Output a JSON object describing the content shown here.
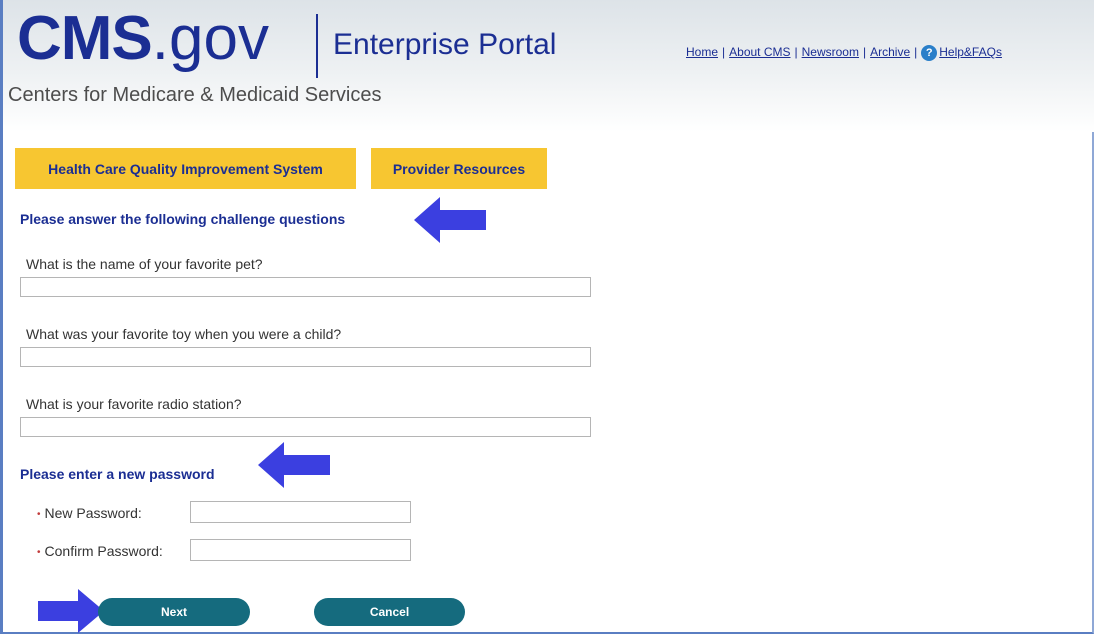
{
  "header": {
    "logo_main": "CMS",
    "logo_suffix": ".gov",
    "portal_title": "Enterprise Portal",
    "tagline": "Centers for Medicare & Medicaid Services",
    "nav": {
      "home": "Home",
      "about": "About CMS",
      "newsroom": "Newsroom",
      "archive": "Archive",
      "help": "Help&FAQs",
      "separator": "|"
    }
  },
  "tabs": {
    "hcqis": "Health Care Quality Improvement System",
    "provider": "Provider Resources"
  },
  "challenge": {
    "title": "Please answer the following challenge questions",
    "q1": "What is the name of your favorite pet?",
    "q2": "What was your favorite toy when you were a child?",
    "q3": "What is your favorite radio station?",
    "a1": "",
    "a2": "",
    "a3": ""
  },
  "password": {
    "title": "Please enter a new password",
    "new_label": "New Password:",
    "confirm_label": "Confirm Password:",
    "required_marker": "•",
    "new_value": "",
    "confirm_value": ""
  },
  "actions": {
    "next": "Next",
    "cancel": "Cancel"
  },
  "colors": {
    "brand_blue": "#1b2e93",
    "tab_yellow": "#f7c631",
    "button_teal": "#156b7e",
    "arrow_blue": "#3b3fe0"
  },
  "icons": {
    "help": "question-circle-icon",
    "pointer": "arrow-left-icon",
    "pointer_right": "arrow-right-icon"
  }
}
